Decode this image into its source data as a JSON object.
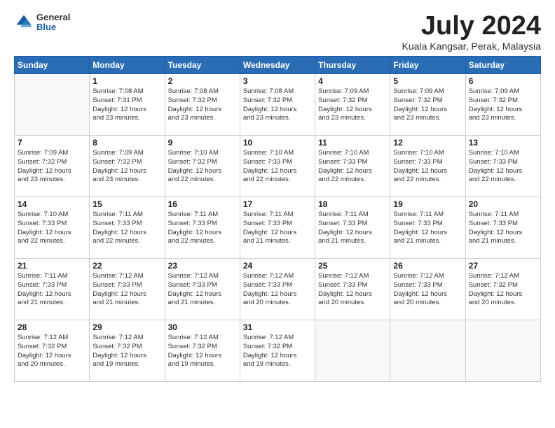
{
  "logo": {
    "general": "General",
    "blue": "Blue"
  },
  "header": {
    "month_year": "July 2024",
    "location": "Kuala Kangsar, Perak, Malaysia"
  },
  "days_of_week": [
    "Sunday",
    "Monday",
    "Tuesday",
    "Wednesday",
    "Thursday",
    "Friday",
    "Saturday"
  ],
  "weeks": [
    [
      {
        "day": "",
        "info": ""
      },
      {
        "day": "1",
        "info": "Sunrise: 7:08 AM\nSunset: 7:31 PM\nDaylight: 12 hours\nand 23 minutes."
      },
      {
        "day": "2",
        "info": "Sunrise: 7:08 AM\nSunset: 7:32 PM\nDaylight: 12 hours\nand 23 minutes."
      },
      {
        "day": "3",
        "info": "Sunrise: 7:08 AM\nSunset: 7:32 PM\nDaylight: 12 hours\nand 23 minutes."
      },
      {
        "day": "4",
        "info": "Sunrise: 7:09 AM\nSunset: 7:32 PM\nDaylight: 12 hours\nand 23 minutes."
      },
      {
        "day": "5",
        "info": "Sunrise: 7:09 AM\nSunset: 7:32 PM\nDaylight: 12 hours\nand 23 minutes."
      },
      {
        "day": "6",
        "info": "Sunrise: 7:09 AM\nSunset: 7:32 PM\nDaylight: 12 hours\nand 23 minutes."
      }
    ],
    [
      {
        "day": "7",
        "info": ""
      },
      {
        "day": "8",
        "info": "Sunrise: 7:09 AM\nSunset: 7:32 PM\nDaylight: 12 hours\nand 23 minutes."
      },
      {
        "day": "9",
        "info": "Sunrise: 7:10 AM\nSunset: 7:32 PM\nDaylight: 12 hours\nand 22 minutes."
      },
      {
        "day": "10",
        "info": "Sunrise: 7:10 AM\nSunset: 7:33 PM\nDaylight: 12 hours\nand 22 minutes."
      },
      {
        "day": "11",
        "info": "Sunrise: 7:10 AM\nSunset: 7:33 PM\nDaylight: 12 hours\nand 22 minutes."
      },
      {
        "day": "12",
        "info": "Sunrise: 7:10 AM\nSunset: 7:33 PM\nDaylight: 12 hours\nand 22 minutes."
      },
      {
        "day": "13",
        "info": "Sunrise: 7:10 AM\nSunset: 7:33 PM\nDaylight: 12 hours\nand 22 minutes."
      }
    ],
    [
      {
        "day": "14",
        "info": ""
      },
      {
        "day": "15",
        "info": "Sunrise: 7:11 AM\nSunset: 7:33 PM\nDaylight: 12 hours\nand 22 minutes."
      },
      {
        "day": "16",
        "info": "Sunrise: 7:11 AM\nSunset: 7:33 PM\nDaylight: 12 hours\nand 22 minutes."
      },
      {
        "day": "17",
        "info": "Sunrise: 7:11 AM\nSunset: 7:33 PM\nDaylight: 12 hours\nand 21 minutes."
      },
      {
        "day": "18",
        "info": "Sunrise: 7:11 AM\nSunset: 7:33 PM\nDaylight: 12 hours\nand 21 minutes."
      },
      {
        "day": "19",
        "info": "Sunrise: 7:11 AM\nSunset: 7:33 PM\nDaylight: 12 hours\nand 21 minutes."
      },
      {
        "day": "20",
        "info": "Sunrise: 7:11 AM\nSunset: 7:33 PM\nDaylight: 12 hours\nand 21 minutes."
      }
    ],
    [
      {
        "day": "21",
        "info": ""
      },
      {
        "day": "22",
        "info": "Sunrise: 7:12 AM\nSunset: 7:33 PM\nDaylight: 12 hours\nand 21 minutes."
      },
      {
        "day": "23",
        "info": "Sunrise: 7:12 AM\nSunset: 7:33 PM\nDaylight: 12 hours\nand 21 minutes."
      },
      {
        "day": "24",
        "info": "Sunrise: 7:12 AM\nSunset: 7:33 PM\nDaylight: 12 hours\nand 20 minutes."
      },
      {
        "day": "25",
        "info": "Sunrise: 7:12 AM\nSunset: 7:33 PM\nDaylight: 12 hours\nand 20 minutes."
      },
      {
        "day": "26",
        "info": "Sunrise: 7:12 AM\nSunset: 7:33 PM\nDaylight: 12 hours\nand 20 minutes."
      },
      {
        "day": "27",
        "info": "Sunrise: 7:12 AM\nSunset: 7:32 PM\nDaylight: 12 hours\nand 20 minutes."
      }
    ],
    [
      {
        "day": "28",
        "info": "Sunrise: 7:12 AM\nSunset: 7:32 PM\nDaylight: 12 hours\nand 20 minutes."
      },
      {
        "day": "29",
        "info": "Sunrise: 7:12 AM\nSunset: 7:32 PM\nDaylight: 12 hours\nand 19 minutes."
      },
      {
        "day": "30",
        "info": "Sunrise: 7:12 AM\nSunset: 7:32 PM\nDaylight: 12 hours\nand 19 minutes."
      },
      {
        "day": "31",
        "info": "Sunrise: 7:12 AM\nSunset: 7:32 PM\nDaylight: 12 hours\nand 19 minutes."
      },
      {
        "day": "",
        "info": ""
      },
      {
        "day": "",
        "info": ""
      },
      {
        "day": "",
        "info": ""
      }
    ]
  ],
  "week7_sunday": {
    "info": "Sunrise: 7:09 AM\nSunset: 7:32 PM\nDaylight: 12 hours\nand 23 minutes."
  },
  "week14_sunday": {
    "info": "Sunrise: 7:10 AM\nSunset: 7:33 PM\nDaylight: 12 hours\nand 22 minutes."
  },
  "week21_sunday": {
    "info": "Sunrise: 7:11 AM\nSunset: 7:33 PM\nDaylight: 12 hours\nand 21 minutes."
  }
}
